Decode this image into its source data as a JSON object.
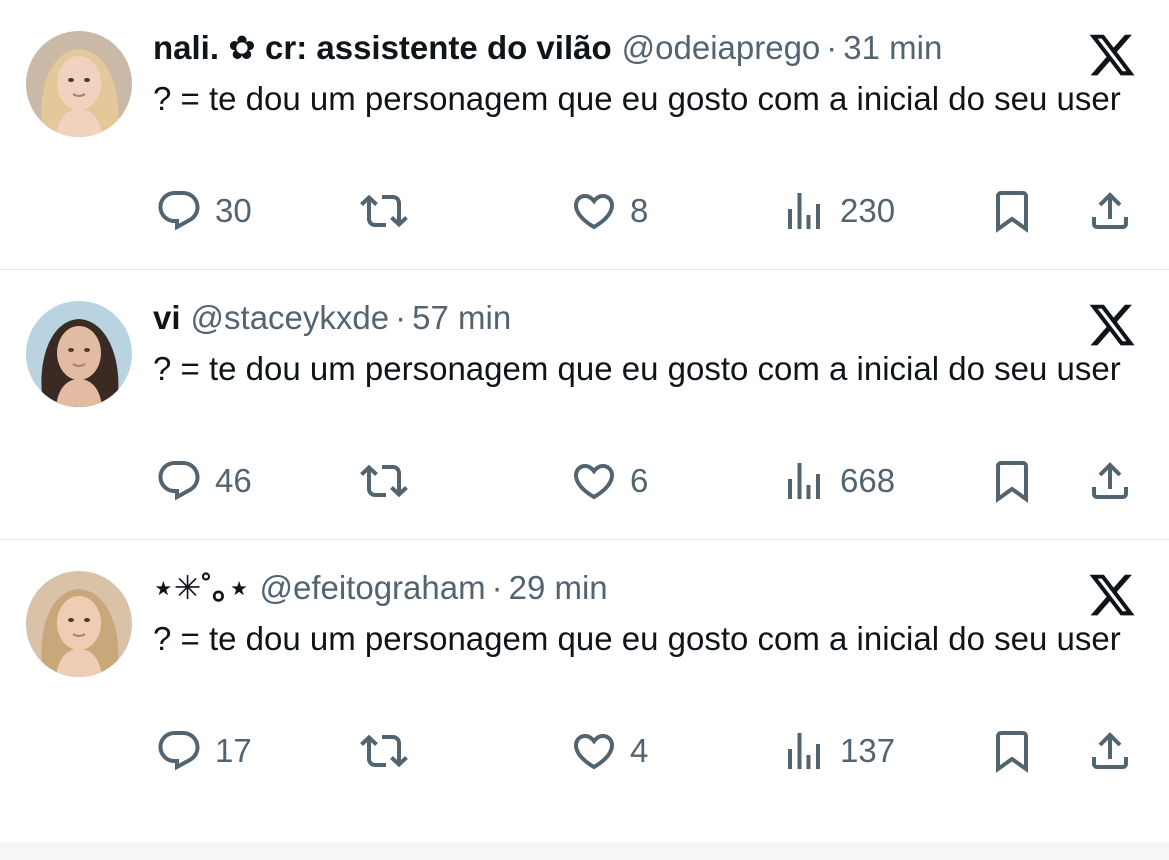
{
  "tweets": [
    {
      "display_name": "nali. ✿ cr: assistente do vilão",
      "handle": "@odeiaprego",
      "separator": "·",
      "time": "31 min",
      "text": "? = te dou um personagem que eu gosto com a inicial do seu user",
      "replies": "30",
      "likes": "8",
      "views": "230",
      "avatar_colors": {
        "bg": "#c9b9a6",
        "hair": "#e3c89a",
        "skin": "#efd3bf"
      }
    },
    {
      "display_name": "vi",
      "handle": "@staceykxde",
      "separator": "·",
      "time": "57 min",
      "text": "? = te dou um personagem que eu gosto com a inicial do seu user",
      "replies": "46",
      "likes": "6",
      "views": "668",
      "avatar_colors": {
        "bg": "#b9d4e0",
        "hair": "#3a2a24",
        "skin": "#e2bba2"
      }
    },
    {
      "display_name": "⋆✳︎˚｡⋆",
      "handle": "@efeitograham",
      "separator": "·",
      "time": "29 min",
      "text": "? = te dou um personagem que eu gosto com a inicial do seu user",
      "replies": "17",
      "likes": "4",
      "views": "137",
      "avatar_colors": {
        "bg": "#d9c2a8",
        "hair": "#caa77a",
        "skin": "#efcdb4"
      }
    }
  ],
  "icons": {
    "reply": "reply-icon",
    "retweet": "retweet-icon",
    "like": "heart-icon",
    "views": "views-icon",
    "bookmark": "bookmark-icon",
    "share": "share-icon",
    "brand": "x-logo-icon"
  },
  "colors": {
    "text_primary": "#0f1419",
    "text_secondary": "#536471",
    "divider": "#e1e6ea"
  }
}
